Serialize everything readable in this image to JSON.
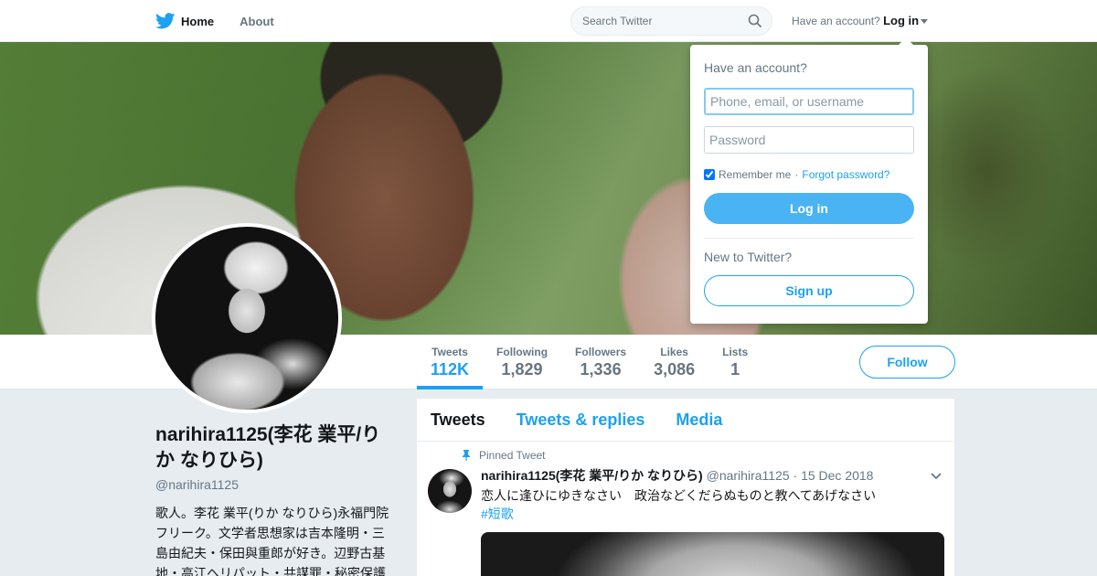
{
  "nav": {
    "home_label": "Home",
    "about_label": "About",
    "search_placeholder": "Search Twitter",
    "account_prompt": "Have an account?",
    "login_label": "Log in"
  },
  "profile": {
    "name": "narihira1125(李花 業平/りか なりひら)",
    "handle": "@narihira1125",
    "bio": "歌人。李花 業平(りか なりひら)永福門院フリーク。文学者思想家は吉本隆明・三島由紀夫・保田與重郎が好き。辺野古基地・高江ヘリパット・共謀罪・秘密保護"
  },
  "stats": [
    {
      "label": "Tweets",
      "value": "112K"
    },
    {
      "label": "Following",
      "value": "1,829"
    },
    {
      "label": "Followers",
      "value": "1,336"
    },
    {
      "label": "Likes",
      "value": "3,086"
    },
    {
      "label": "Lists",
      "value": "1"
    }
  ],
  "follow_label": "Follow",
  "timeline": {
    "tabs": [
      "Tweets",
      "Tweets & replies",
      "Media"
    ],
    "pinned_label": "Pinned Tweet",
    "tweet": {
      "name": "narihira1125(李花 業平/りか なりひら)",
      "handle": "@narihira1125",
      "date": "15 Dec 2018",
      "text": "恋人に逢ひにゆきなさい　政治などくだらぬものと教へてあげなさい",
      "hashtag": "#短歌"
    }
  },
  "login_dropdown": {
    "title": "Have an account?",
    "username_placeholder": "Phone, email, or username",
    "password_placeholder": "Password",
    "remember_label": "Remember me",
    "separator": "·",
    "forgot_label": "Forgot password?",
    "login_button": "Log in",
    "new_prompt": "New to Twitter?",
    "signup_button": "Sign up"
  },
  "colors": {
    "accent": "#1da1f2",
    "login_button": "#4ab3f4",
    "background": "#e6ecf0"
  },
  "icons": [
    "twitter-bird-icon",
    "search-icon",
    "caret-down-icon",
    "pin-icon",
    "chevron-down-icon"
  ]
}
